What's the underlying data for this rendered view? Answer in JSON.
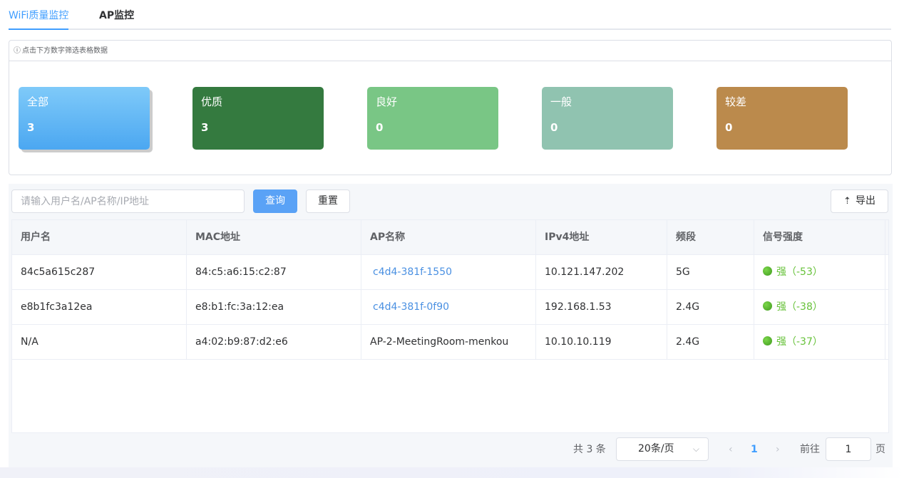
{
  "tabs": [
    {
      "label": "WiFi质量监控",
      "active": true
    },
    {
      "label": "AP监控",
      "active": false
    }
  ],
  "stats": {
    "hint": "点击下方数字筛选表格数据",
    "cards": [
      {
        "label": "全部",
        "count": "3",
        "color": "#4ba7f1"
      },
      {
        "label": "优质",
        "count": "3",
        "color": "#347a3f"
      },
      {
        "label": "良好",
        "count": "0",
        "color": "#79c685"
      },
      {
        "label": "一般",
        "count": "0",
        "color": "#90c3b0"
      },
      {
        "label": "较差",
        "count": "0",
        "color": "#bb8a4c"
      }
    ]
  },
  "search": {
    "placeholder": "请输入用户名/AP名称/IP地址",
    "query_label": "查询",
    "reset_label": "重置",
    "export_label": "导出"
  },
  "table": {
    "headers": [
      "用户名",
      "MAC地址",
      "AP名称",
      "IPv4地址",
      "频段",
      "信号强度"
    ],
    "rows": [
      {
        "user": "84c5a615c287",
        "mac": "84:c5:a6:15:c2:87",
        "ap": "c4d4-381f-1550",
        "ip": "10.121.147.202",
        "band": "5G",
        "signal": "强（-53）"
      },
      {
        "user": "e8b1fc3a12ea",
        "mac": "e8:b1:fc:3a:12:ea",
        "ap": "c4d4-381f-0f90",
        "ip": "192.168.1.53",
        "band": "2.4G",
        "signal": "强（-38）"
      },
      {
        "user": "N/A",
        "mac": "a4:02:b9:87:d2:e6",
        "ap": "AP-2-MeetingRoom-menkou",
        "ip": "10.10.10.119",
        "band": "2.4G",
        "signal": "强（-37）"
      }
    ]
  },
  "pagination": {
    "total": "共 3 条",
    "page_size": "20条/页",
    "current_page": "1",
    "goto_prefix": "前往",
    "goto_value": "1",
    "goto_suffix": "页"
  },
  "colors": {
    "accent": "#409eff",
    "signal_good": "#67c23a"
  },
  "icons": {
    "info": "info-circle-icon",
    "export": "upload-icon",
    "select": "chevron-down-icon"
  }
}
